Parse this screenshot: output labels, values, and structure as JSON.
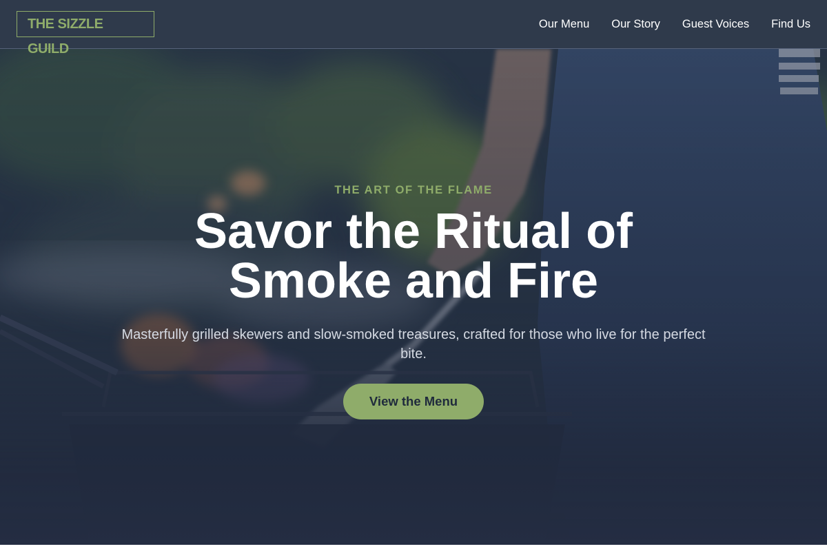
{
  "header": {
    "logo": "THE SIZZLE GUILD",
    "nav": [
      "Our Menu",
      "Our Story",
      "Guest Voices",
      "Find Us"
    ]
  },
  "hero": {
    "eyebrow": "THE ART OF THE FLAME",
    "headline": "Savor the Ritual of Smoke and Fire",
    "subtitle": "Masterfully grilled skewers and slow-smoked treasures, crafted for those who live for the perfect bite.",
    "cta": "View the Menu",
    "background_image": "grill-master-photo"
  },
  "colors": {
    "accent": "#8fac6a",
    "navbar": "#2f3a4b",
    "hero_base": "#253044",
    "text_light": "#ffffff"
  }
}
